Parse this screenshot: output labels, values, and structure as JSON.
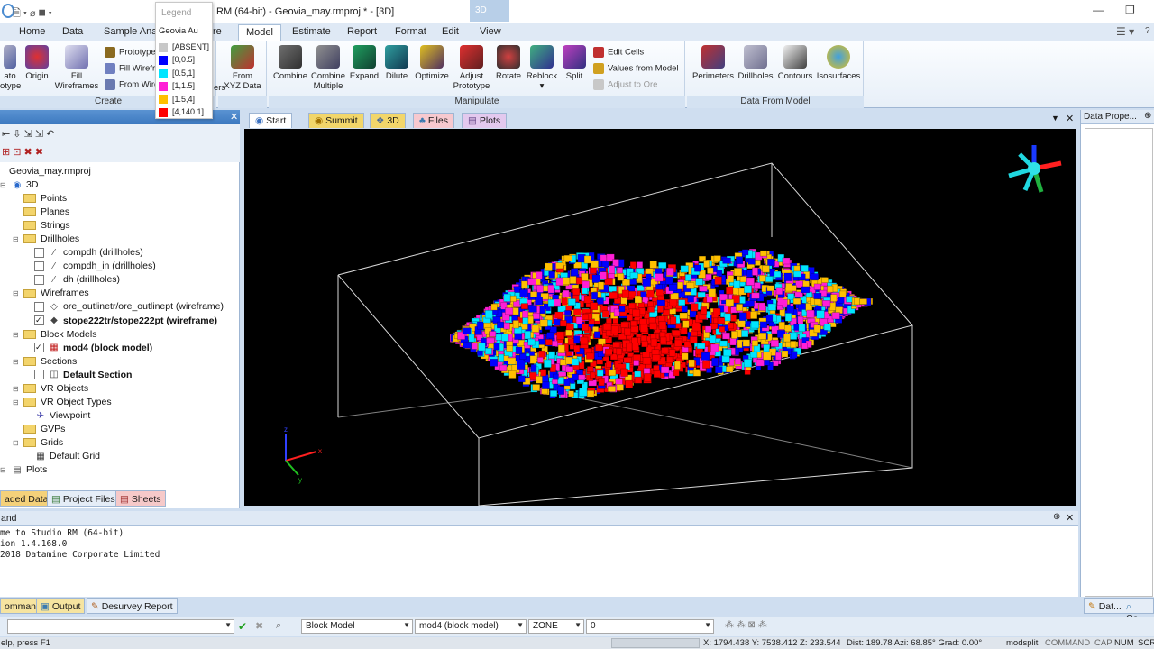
{
  "window": {
    "title": "RM (64-bit) - Geovia_may.rmproj * - [3D]",
    "context_tab": "3D"
  },
  "ribbon_tabs": [
    "Home",
    "Data",
    "Sample Analy",
    "re",
    "Model",
    "Estimate",
    "Report",
    "Format",
    "Edit",
    "View"
  ],
  "ribbon_active_tab": "Model",
  "ribbon": {
    "create": {
      "label": "Create",
      "buttons": [
        {
          "label": "ato\notype"
        },
        {
          "label": "Origin"
        },
        {
          "label": "Fill\nWireframes"
        }
      ],
      "small": [
        "Prototype",
        "Fill Wirefra",
        "From Wire"
      ],
      "extra_text": "ers"
    },
    "from_xyz": {
      "label": "From\nXYZ Data"
    },
    "manipulate": {
      "label": "Manipulate",
      "buttons": [
        {
          "label": "Combine"
        },
        {
          "label": "Combine\nMultiple"
        },
        {
          "label": "Expand"
        },
        {
          "label": "Dilute"
        },
        {
          "label": "Optimize"
        },
        {
          "label": "Adjust\nPrototype"
        },
        {
          "label": "Rotate"
        },
        {
          "label": "Reblock\n▾"
        },
        {
          "label": "Split"
        }
      ],
      "small": [
        "Edit Cells",
        "Values from Model",
        "Adjust to Ore"
      ]
    },
    "data_from_model": {
      "label": "Data From Model",
      "buttons": [
        {
          "label": "Perimeters"
        },
        {
          "label": "Drillholes"
        },
        {
          "label": "Contours"
        },
        {
          "label": "Isosurfaces"
        }
      ]
    }
  },
  "legend": {
    "header": "Legend",
    "title": "Geovia Au",
    "items": [
      {
        "label": "[ABSENT]",
        "color": "#c8c8c8"
      },
      {
        "label": "[0,0.5]",
        "color": "#0000ff"
      },
      {
        "label": "[0.5,1]",
        "color": "#00e5ff"
      },
      {
        "label": "[1,1.5]",
        "color": "#ff1fd6"
      },
      {
        "label": "[1.5,4]",
        "color": "#ffc000"
      },
      {
        "label": "[4,140.1]",
        "color": "#ff0000"
      }
    ]
  },
  "tree": {
    "root": "Geovia_may.rmproj",
    "items": [
      {
        "label": "3D",
        "level": 0
      },
      {
        "label": "Points",
        "level": 1
      },
      {
        "label": "Planes",
        "level": 1
      },
      {
        "label": "Strings",
        "level": 1
      },
      {
        "label": "Drillholes",
        "level": 1
      },
      {
        "label": "compdh (drillholes)",
        "level": 2
      },
      {
        "label": "compdh_in (drillholes)",
        "level": 2
      },
      {
        "label": "dh (drillholes)",
        "level": 2
      },
      {
        "label": "Wireframes",
        "level": 1
      },
      {
        "label": "ore_outlinetr/ore_outlinept (wireframe)",
        "level": 2
      },
      {
        "label": "stope222tr/stope222pt (wireframe)",
        "level": 2
      },
      {
        "label": "Block Models",
        "level": 1
      },
      {
        "label": "mod4 (block model)",
        "level": 2
      },
      {
        "label": "Sections",
        "level": 1
      },
      {
        "label": "Default Section",
        "level": 2
      },
      {
        "label": "VR Objects",
        "level": 1
      },
      {
        "label": "VR Object Types",
        "level": 1
      },
      {
        "label": "Viewpoint",
        "level": 2
      },
      {
        "label": "GVPs",
        "level": 1
      },
      {
        "label": "Grids",
        "level": 1
      },
      {
        "label": "Default Grid",
        "level": 2
      },
      {
        "label": "Plots",
        "level": 0
      }
    ]
  },
  "tree_tabs": [
    "aded Data",
    "Project Files",
    "Sheets"
  ],
  "doc_tabs": [
    "Start",
    "Summit",
    "3D",
    "Files",
    "Plots"
  ],
  "right_panel": {
    "title": "Data Prope..."
  },
  "command": {
    "header": "and",
    "lines": [
      "me to Studio RM (64-bit)",
      "ion 1.4.168.0",
      "2018 Datamine Corporate Limited"
    ]
  },
  "output_tabs": [
    "ommand",
    "Output",
    "Desurvey Report"
  ],
  "right_bottom_tabs": [
    "Dat...",
    "Co..."
  ],
  "cmdbar": {
    "input_value": "",
    "type_value": "Block Model",
    "object_value": "mod4 (block model)",
    "field_value": "ZONE",
    "value_value": "0"
  },
  "status": {
    "help": "elp, press F1",
    "coords": "X: 1794.438  Y: 7538.412  Z: 233.544",
    "view": "Dist: 189.78 Azi: 68.85° Grad: 0.00°",
    "command": "modsplit",
    "flags": [
      "COMMAND",
      "CAP",
      "NUM",
      "SCR"
    ]
  }
}
